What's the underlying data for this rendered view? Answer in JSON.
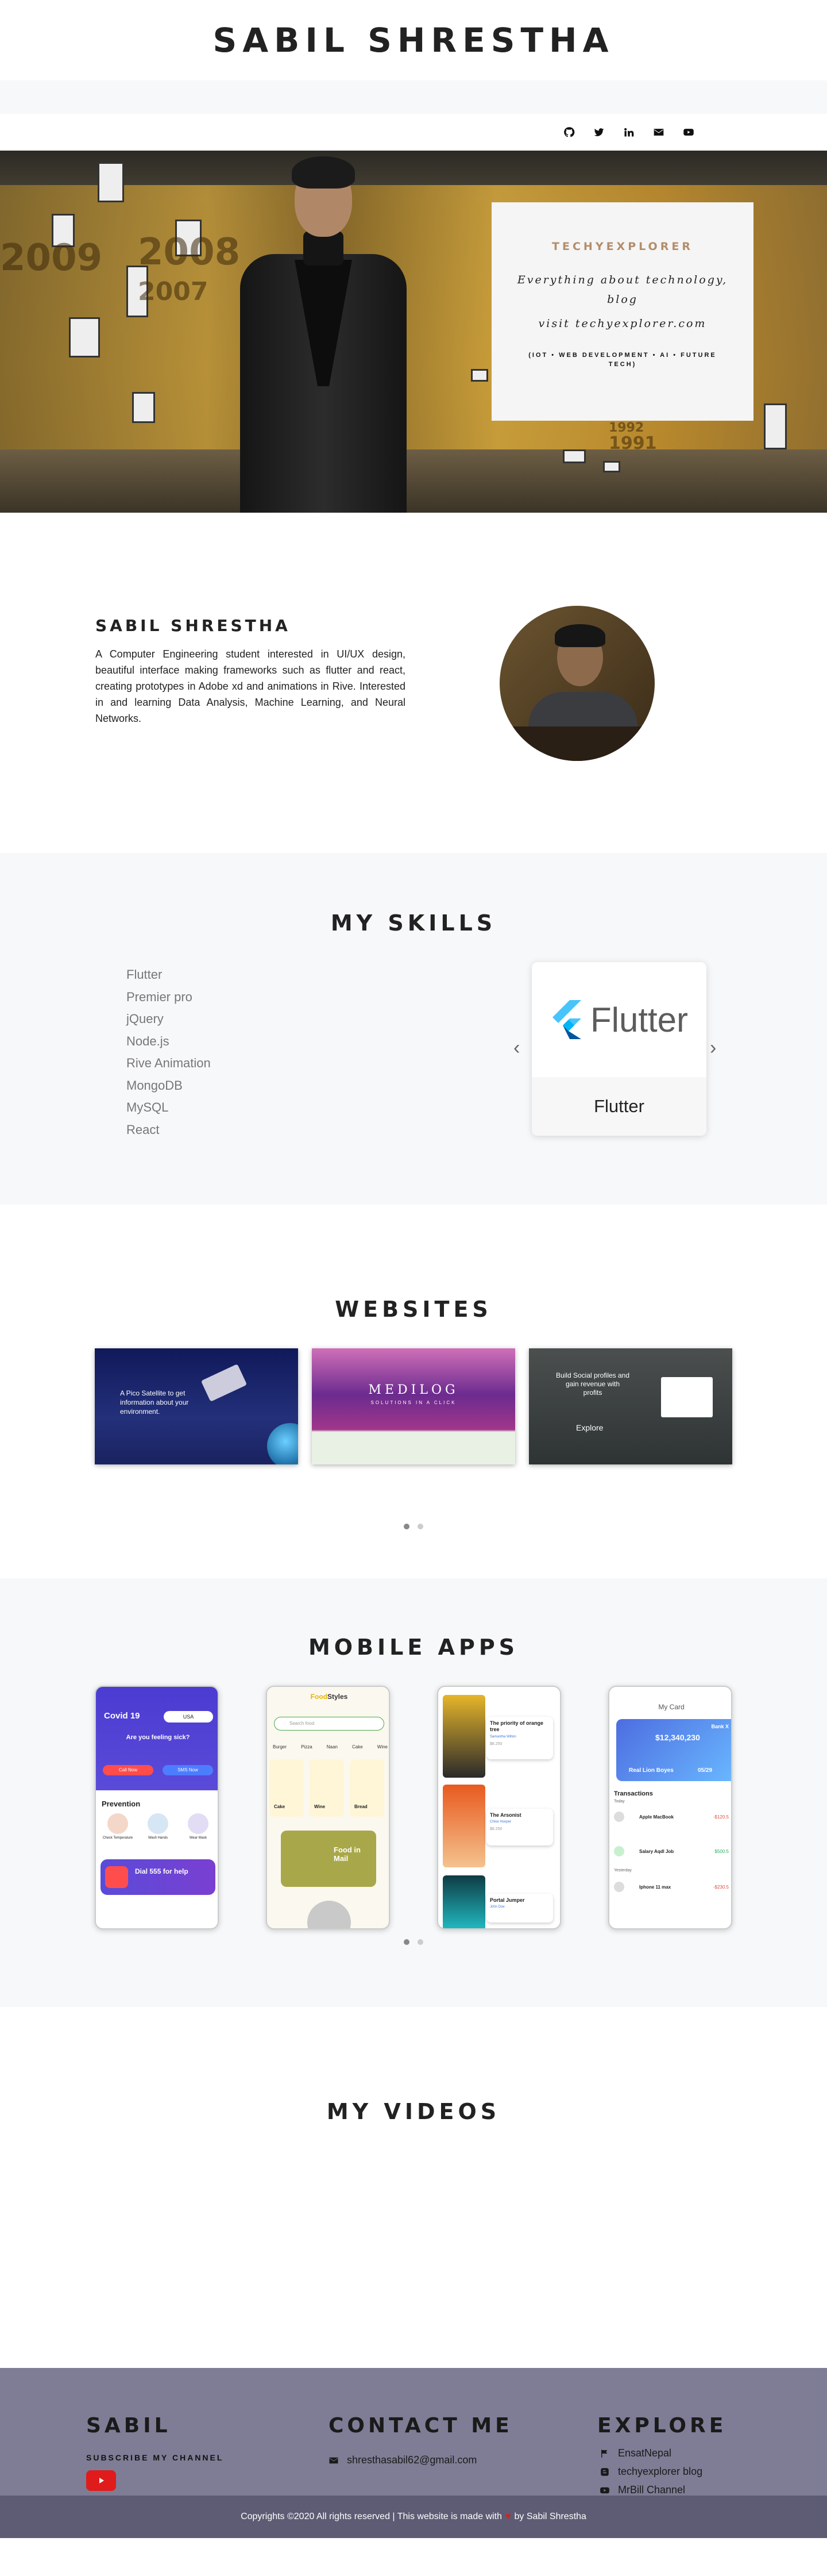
{
  "header": {
    "title": "SABIL SHRESTHA"
  },
  "social": [
    {
      "icon": "github-icon"
    },
    {
      "icon": "twitter-icon"
    },
    {
      "icon": "linkedin-icon"
    },
    {
      "icon": "email-icon"
    },
    {
      "icon": "youtube-icon"
    }
  ],
  "hero": {
    "promo": {
      "brand": "TECHYEXPLORER",
      "line1": "Everything about technology, blog",
      "line2": "visit techyexplorer.com",
      "tags": "(IOT • WEB DEVELOPMENT • AI • FUTURE TECH)"
    },
    "years": [
      "2009",
      "2008",
      "2007",
      "1992",
      "1991"
    ]
  },
  "about": {
    "name": "SABIL SHRESTHA",
    "bio": "A Computer Engineering student interested in UI/UX design, beautiful interface making frameworks such as flutter and react, creating prototypes in Adobe xd and animations in Rive. Interested in and learning Data Analysis, Machine Learning, and Neural Networks."
  },
  "skills": {
    "title": "MY SKILLS",
    "items": [
      "Flutter",
      "Premier pro",
      "jQuery",
      "Node.js",
      "Rive Animation",
      "MongoDB",
      "MySQL",
      "React"
    ],
    "carousel": {
      "logo_text": "Flutter",
      "caption": "Flutter",
      "prev": "‹",
      "next": "›"
    }
  },
  "websites": {
    "title": "WEBSITES",
    "shots": [
      {
        "heading": "A Pico Satellite to get information about your environment.",
        "bg": "#1f2a6b"
      },
      {
        "heading": "MEDILOG",
        "sub": "SOLUTIONS IN A CLICK",
        "bg": "#5b1f6b"
      },
      {
        "heading": "Build Social profiles and gain revenue with profits",
        "button": "Explore",
        "bg": "#3a3d40"
      }
    ]
  },
  "mobile": {
    "title": "MOBILE APPS",
    "phones": [
      {
        "app": "Covid 19",
        "badge": "USA",
        "question": "Are you feeling sick?",
        "call_now": "Call Now",
        "sms_now": "SMS Now",
        "section": "Prevention",
        "items": [
          "Check Temperature",
          "Wash Hands",
          "Wear Mask"
        ],
        "cta": "Dial 555 for help"
      },
      {
        "brand_a": "Food",
        "brand_b": "Styles",
        "search": "Search food",
        "tabs": [
          "Burger",
          "Pizza",
          "Naan",
          "Cake",
          "Wine"
        ],
        "foods": [
          "Cake",
          "Wine",
          "Bread"
        ],
        "promo": "Food in Mail"
      },
      {
        "books": [
          {
            "title": "The priority of orange tree",
            "author": "Samantha Wilton",
            "price": "$8.250"
          },
          {
            "title": "The Arsonist",
            "author": "Chloe Hooper",
            "price": "$8.250"
          },
          {
            "title": "Portal Jumper",
            "author": "John Doe",
            "price": ""
          }
        ]
      },
      {
        "title": "My Card",
        "bank": "Bank X",
        "amount": "$12,340,230",
        "holder": "Real Lion Boyes",
        "expiry": "05/29",
        "transactions_label": "Transactions",
        "today": "Today",
        "yesterday": "Yesterday",
        "rows": [
          {
            "name": "Apple MacBook",
            "sub": "Transaction",
            "amt": "-$120.5",
            "color": "#e74c3c"
          },
          {
            "name": "Salary Aqdl Job",
            "sub": "Transaction",
            "amt": "$500.5",
            "color": "#27ae60"
          },
          {
            "name": "Iphone 11 max",
            "sub": "Transaction",
            "amt": "-$230.5",
            "color": "#e74c3c"
          }
        ]
      }
    ]
  },
  "videos": {
    "title": "MY VIDEOS"
  },
  "footer": {
    "brand": "SABIL",
    "subscribe": "SUBSCRIBE MY CHANNEL",
    "contact_title": "CONTACT ME",
    "email": "shresthasabil62@gmail.com",
    "explore_title": "EXPLORE",
    "links": [
      "EnsatNepal",
      "techyexplorer blog",
      "MrBill Channel"
    ],
    "copyright_left": "Copyrights ©2020 All rights reserved | This website is made with",
    "heart": "♥",
    "copyright_right": "by Sabil Shrestha"
  },
  "colors": {
    "accent": "#b48d6a",
    "footer_bg": "#7e7d95",
    "footer_bar": "#5d5c74",
    "youtube": "#e01b1b"
  }
}
